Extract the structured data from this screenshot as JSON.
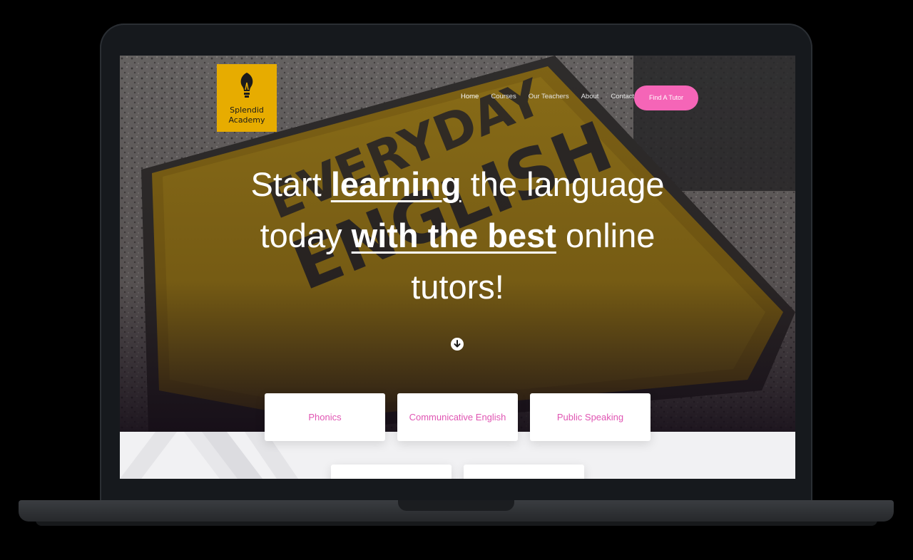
{
  "brand": {
    "line1": "Splendid",
    "line2": "Academy",
    "logo_color": "#e7ac00"
  },
  "nav": {
    "items": [
      "Home",
      "Courses",
      "Our Teachers",
      "About",
      "Contact"
    ],
    "active": "Home",
    "cta_label": "Find A Tutor",
    "cta_color": "#f565b7"
  },
  "hero": {
    "headline": {
      "part1": "Start ",
      "bold1": "learning",
      "part2": " the language today ",
      "bold2": "with the best",
      "part3": " online tutors!"
    },
    "scroll_icon": "arrow-down-circle-icon"
  },
  "courses": {
    "cards": [
      "Phonics",
      "Communicative English",
      "Public Speaking"
    ],
    "accent_color": "#e055b3"
  }
}
